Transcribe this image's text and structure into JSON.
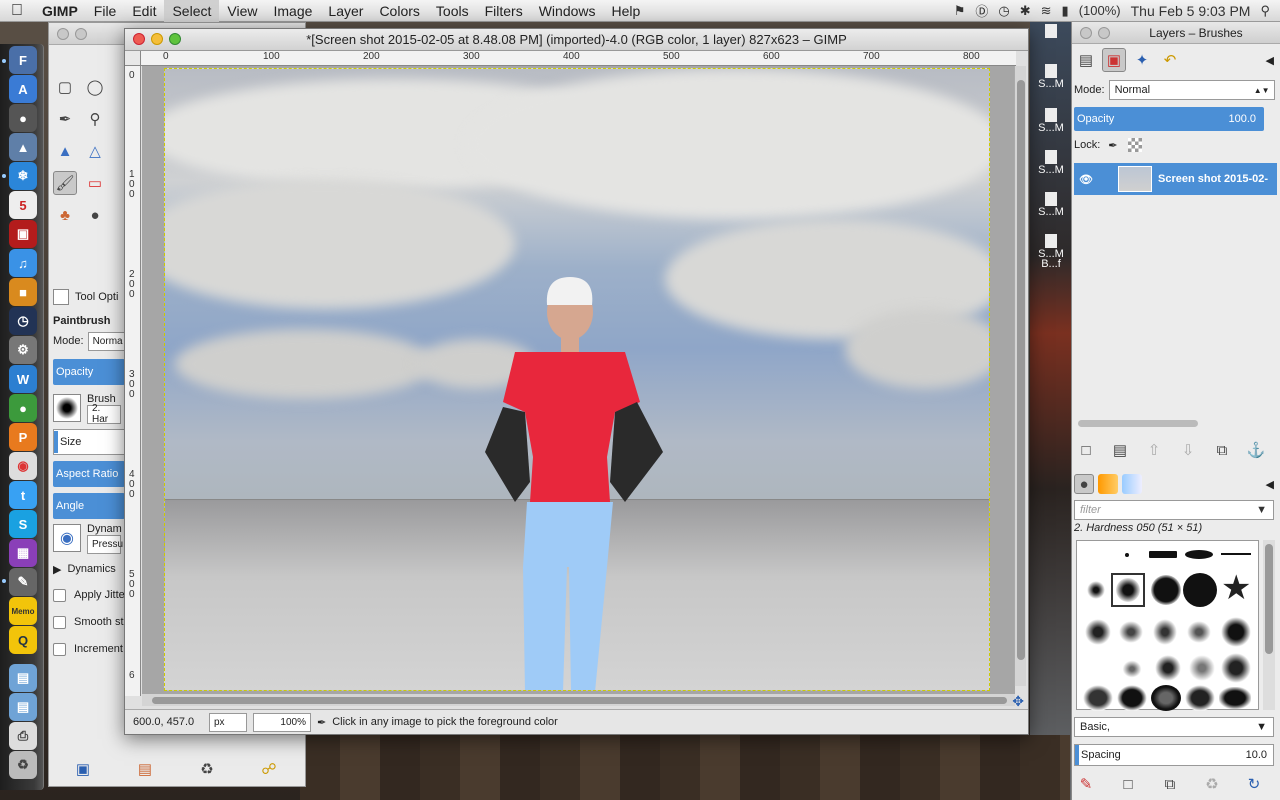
{
  "menubar": {
    "app_name": "GIMP",
    "items": [
      "File",
      "Edit",
      "Select",
      "View",
      "Image",
      "Layer",
      "Colors",
      "Tools",
      "Filters",
      "Windows",
      "Help"
    ],
    "battery": "(100%)",
    "clock": "Thu Feb 5  9:03 PM"
  },
  "toolbox": {
    "tool_options_label": "Tool Opti",
    "tool_name": "Paintbrush",
    "mode_label": "Mode:",
    "mode_value": "Norma",
    "opacity_label": "Opacity",
    "brush_label": "Brush",
    "brush_value": "2. Har",
    "size_label": "Size",
    "aspect_label": "Aspect Ratio",
    "angle_label": "Angle",
    "dynamics_label": "Dynam",
    "dynamics_value": "Pressu",
    "dynamics_options": "Dynamics",
    "apply_jitter": "Apply Jitte",
    "smooth_stroke": "Smooth st",
    "incremental": "Increment"
  },
  "window": {
    "title": "*[Screen shot 2015-02-05 at 8.48.08 PM] (imported)-4.0 (RGB color, 1 layer) 827x623 – GIMP",
    "ruler_ticks": [
      "0",
      "100",
      "200",
      "300",
      "400",
      "500",
      "600",
      "700",
      "800"
    ],
    "vruler_ticks": [
      "0",
      "1 0 0",
      "2 0 0",
      "3 0 0",
      "4 0 0",
      "5 0 0",
      "6"
    ],
    "coords": "600.0, 457.0",
    "unit": "px",
    "zoom": "100%",
    "status_message": "Click in any image to pick the foreground color"
  },
  "layers": {
    "title": "Layers – Brushes",
    "mode_label": "Mode:",
    "mode_value": "Normal",
    "opacity_label": "Opacity",
    "opacity_value": "100.0",
    "lock_label": "Lock:",
    "layer_name": "Screen shot 2015-02-",
    "filter_placeholder": "filter",
    "brush_name": "2. Hardness 050 (51 × 51)",
    "brush_set": "Basic,",
    "spacing_label": "Spacing",
    "spacing_value": "10.0"
  },
  "side_items": [
    "S...M",
    "S...M",
    "S...M",
    "S...M",
    "S...M",
    "B...f"
  ],
  "colors": {
    "selection_blue": "#4b8fd6",
    "shirt": "#e8273c",
    "pants": "#9fcbf7"
  }
}
